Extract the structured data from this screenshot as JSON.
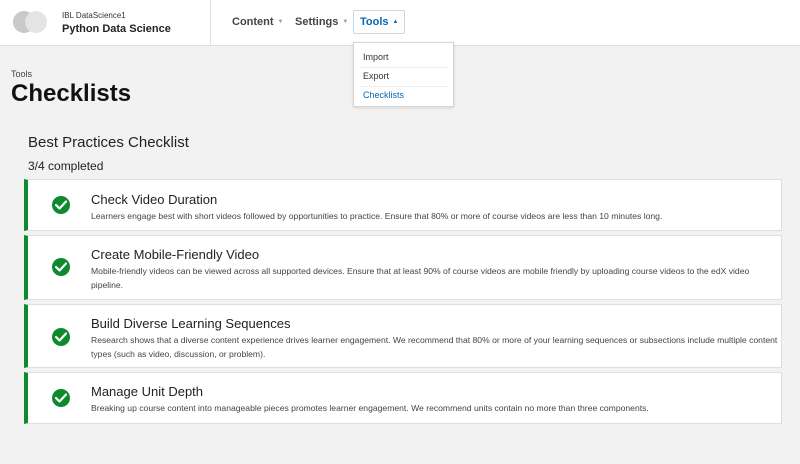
{
  "header": {
    "org": "IBL DataScience1",
    "course": "Python Data Science"
  },
  "nav": [
    {
      "label": "Content"
    },
    {
      "label": "Settings"
    },
    {
      "label": "Tools"
    }
  ],
  "tools_menu": [
    {
      "label": "Import"
    },
    {
      "label": "Export"
    },
    {
      "label": "Checklists"
    }
  ],
  "breadcrumb": "Tools",
  "page_title": "Checklists",
  "checklist": {
    "title": "Best Practices Checklist",
    "progress": "3/4 completed",
    "items": [
      {
        "title": "Check Video Duration",
        "description": "Learners engage best with short videos followed by opportunities to practice. Ensure that 80% or more of course videos are less than 10 minutes long.",
        "completed": true
      },
      {
        "title": "Create Mobile-Friendly Video",
        "description": "Mobile-friendly videos can be viewed across all supported devices. Ensure that at least 90% of course videos are mobile friendly by uploading course videos to the edX video pipeline.",
        "completed": true
      },
      {
        "title": "Build Diverse Learning Sequences",
        "description": "Research shows that a diverse content experience drives learner engagement. We recommend that 80% or more of your learning sequences or subsections include multiple content types (such as video, discussion, or problem).",
        "completed": true
      },
      {
        "title": "Manage Unit Depth",
        "description": "Breaking up course content into manageable pieces promotes learner engagement. We recommend units contain no more than three components.",
        "completed": true
      }
    ]
  },
  "colors": {
    "accent": "#0a68b4",
    "success": "#0d8a2e",
    "background": "#f2f2f2"
  },
  "icons": [
    "logo",
    "chevron-down-icon",
    "chevron-up-icon",
    "check-circle-icon"
  ]
}
